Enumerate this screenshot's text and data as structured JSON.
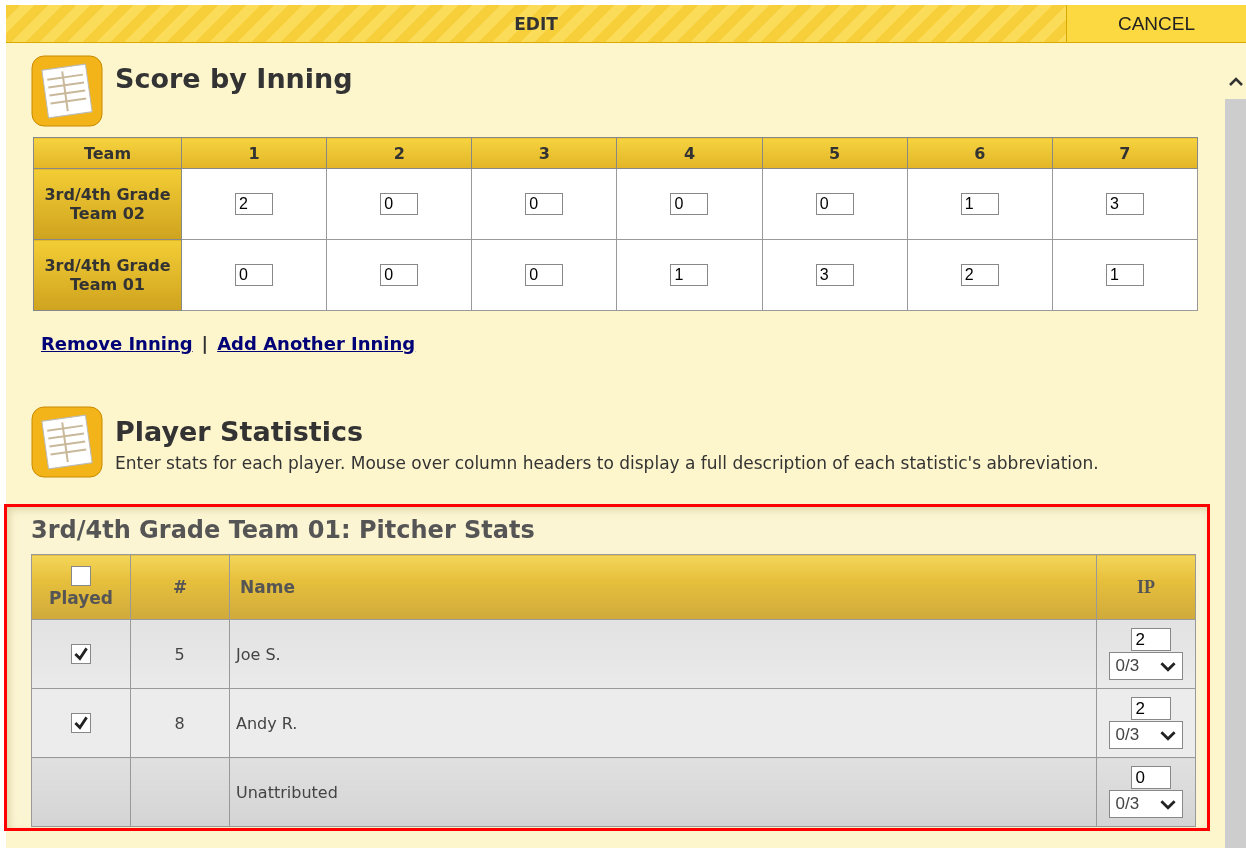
{
  "toolbar": {
    "edit": "EDIT",
    "cancel": "CANCEL"
  },
  "score_section": {
    "title": "Score by Inning",
    "columns": [
      "Team",
      "1",
      "2",
      "3",
      "4",
      "5",
      "6",
      "7"
    ],
    "rows": [
      {
        "team": "3rd/4th Grade Team 02",
        "scores": [
          "2",
          "0",
          "0",
          "0",
          "0",
          "1",
          "3"
        ]
      },
      {
        "team": "3rd/4th Grade Team 01",
        "scores": [
          "0",
          "0",
          "0",
          "1",
          "3",
          "2",
          "1"
        ]
      }
    ],
    "links": [
      "Remove Inning",
      "Add Another Inning"
    ],
    "separator": "|"
  },
  "player_section": {
    "title": "Player Statistics",
    "description": "Enter stats for each player. Mouse over column headers to display a full description of each statistic's abbreviation."
  },
  "pitcher_stats": {
    "title": "3rd/4th Grade Team 01: Pitcher Stats",
    "highlighted": true,
    "columns": {
      "played": "Played",
      "number": "#",
      "name": "Name",
      "ip": "IP"
    },
    "all_played_checked": false,
    "rows": [
      {
        "kind": "player",
        "checked": true,
        "number": "5",
        "name": "Joe S.",
        "ip": "2",
        "ip_fraction": "0/3"
      },
      {
        "kind": "player",
        "checked": true,
        "number": "8",
        "name": "Andy R.",
        "ip": "2",
        "ip_fraction": "0/3"
      },
      {
        "kind": "unattributed",
        "name": "Unattributed",
        "ip": "0",
        "ip_fraction": "0/3"
      }
    ]
  }
}
